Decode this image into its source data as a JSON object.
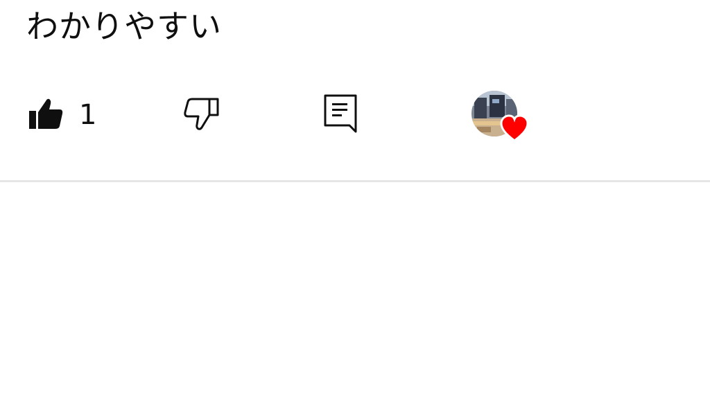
{
  "comment": {
    "text": "わかりやすい",
    "like_count": "1"
  },
  "icons": {
    "like": "thumbs-up-icon",
    "dislike": "thumbs-down-icon",
    "reply": "comment-icon",
    "creator_heart": "heart-icon"
  },
  "colors": {
    "text": "#0f0f0f",
    "heart": "#ff0000",
    "divider": "#e5e5e5"
  }
}
